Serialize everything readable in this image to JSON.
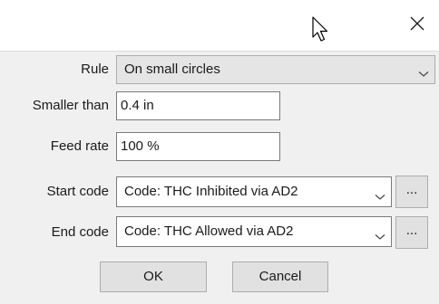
{
  "dialog": {
    "close_glyph": "✕"
  },
  "form": {
    "rule": {
      "label": "Rule",
      "value": "On small circles"
    },
    "smaller_than": {
      "label": "Smaller than",
      "value": "0.4 in"
    },
    "feed_rate": {
      "label": "Feed rate",
      "value": "100 %"
    },
    "start_code": {
      "label": "Start code",
      "value": "Code: THC Inhibited via AD2",
      "browse_label": "..."
    },
    "end_code": {
      "label": "End code",
      "value": "Code: THC Allowed via AD2",
      "browse_label": "..."
    }
  },
  "buttons": {
    "ok_label": "OK",
    "cancel_label": "Cancel"
  },
  "icons": {
    "close": "close-icon",
    "dropdown": "chevron-down-icon",
    "cursor": "mouse-pointer-icon"
  }
}
